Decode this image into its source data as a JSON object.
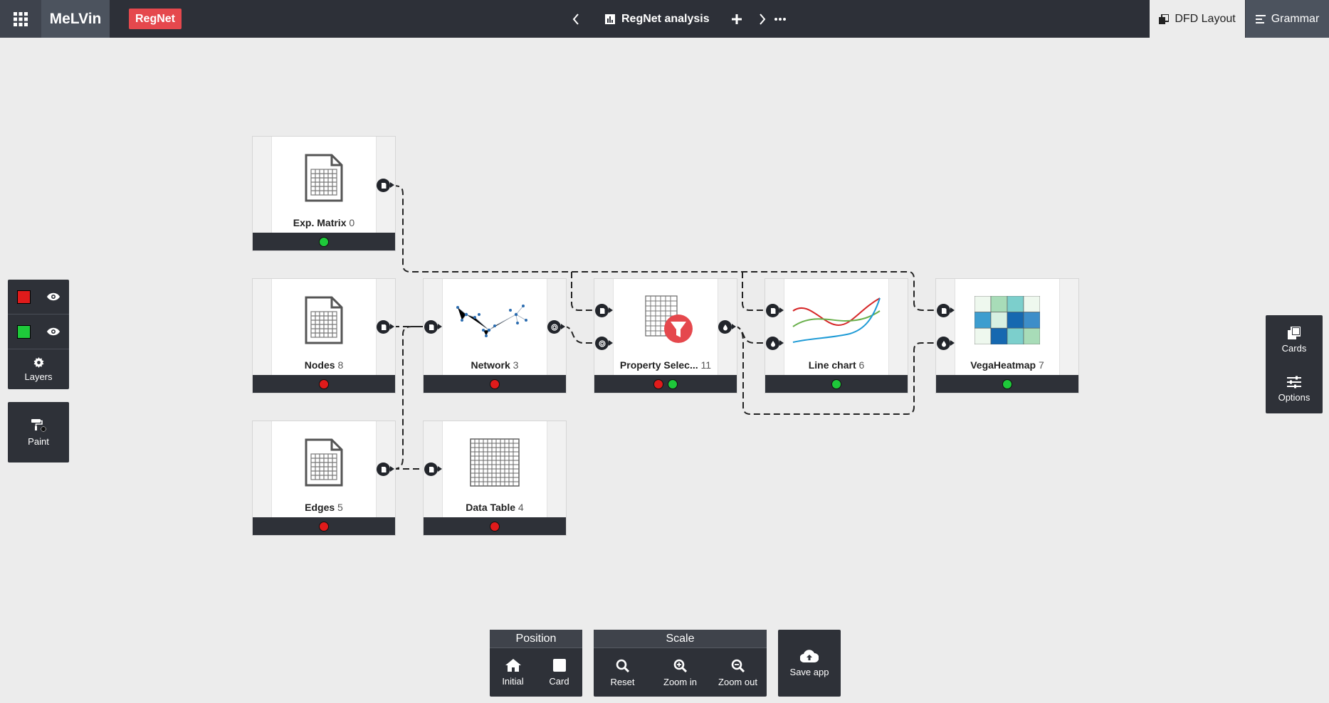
{
  "app": {
    "name": "MeLVin",
    "project_badge": "RegNet",
    "analysis_title": "RegNet analysis"
  },
  "tabs": {
    "dfd_layout": "DFD Layout",
    "grammar": "Grammar"
  },
  "cards": [
    {
      "title": "Exp. Matrix",
      "id": "0"
    },
    {
      "title": "Nodes",
      "id": "8"
    },
    {
      "title": "Network",
      "id": "3"
    },
    {
      "title": "Property Selec...",
      "id": "11"
    },
    {
      "title": "Line chart",
      "id": "6"
    },
    {
      "title": "VegaHeatmap",
      "id": "7"
    },
    {
      "title": "Edges",
      "id": "5"
    },
    {
      "title": "Data Table",
      "id": "4"
    }
  ],
  "layers": {
    "label": "Layers",
    "colors": [
      "#e01b1b",
      "#1ec93a"
    ]
  },
  "paint": {
    "label": "Paint"
  },
  "right_panel": {
    "cards": "Cards",
    "options": "Options"
  },
  "position": {
    "title": "Position",
    "initial": "Initial",
    "card": "Card"
  },
  "scale": {
    "title": "Scale",
    "reset": "Reset",
    "zoom_in": "Zoom in",
    "zoom_out": "Zoom out"
  },
  "save": {
    "label": "Save app"
  }
}
